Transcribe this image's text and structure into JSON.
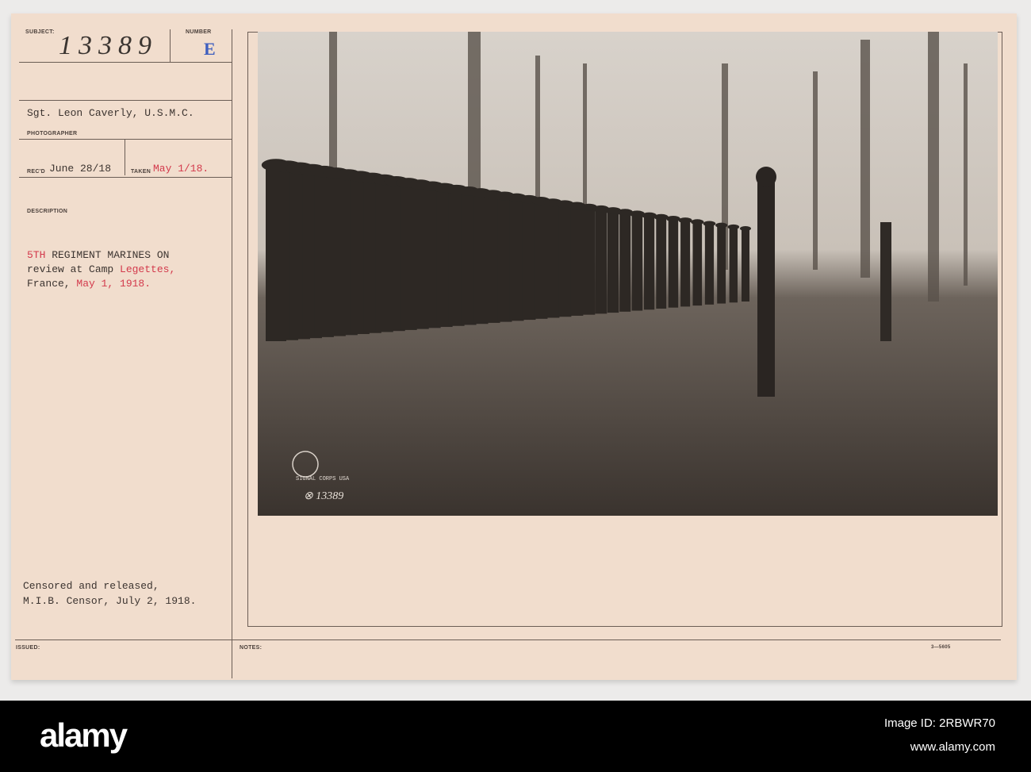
{
  "card": {
    "subject_label": "SUBJECT:",
    "subject_number": "13389",
    "number_label": "NUMBER",
    "number_value": "E",
    "photographer": "Sgt. Leon Caverly, U.S.M.C.",
    "photographer_label": "PHOTOGRAPHER",
    "recd_label": "REC'D",
    "recd_value": "June 28/18",
    "taken_label": "TAKEN",
    "taken_value": "May 1/18.",
    "description_label": "DESCRIPTION",
    "description": {
      "line1_red": "5TH",
      "line1_rest": " REGIMENT MARINES ON",
      "line2_start": "review at Camp ",
      "line2_red": "Legettes,",
      "line3_start": "France, ",
      "line3_red": "May 1, 1918."
    },
    "censor_line1": "Censored and released,",
    "censor_line2": "M.I.B. Censor, July 2, 1918.",
    "issued_label": "ISSUED:",
    "notes_label": "NOTES:",
    "form_number": "3—5605"
  },
  "photo": {
    "stamp_text": "SIGNAL CORPS USA",
    "photo_number": "⊗ 13389"
  },
  "footer": {
    "logo": "alamy",
    "image_id": "Image ID: 2RBWR70",
    "url": "www.alamy.com"
  },
  "colors": {
    "card": "#f1ddcd",
    "red_type": "#d33a4c",
    "blue_stamp": "#3f5fbf"
  }
}
